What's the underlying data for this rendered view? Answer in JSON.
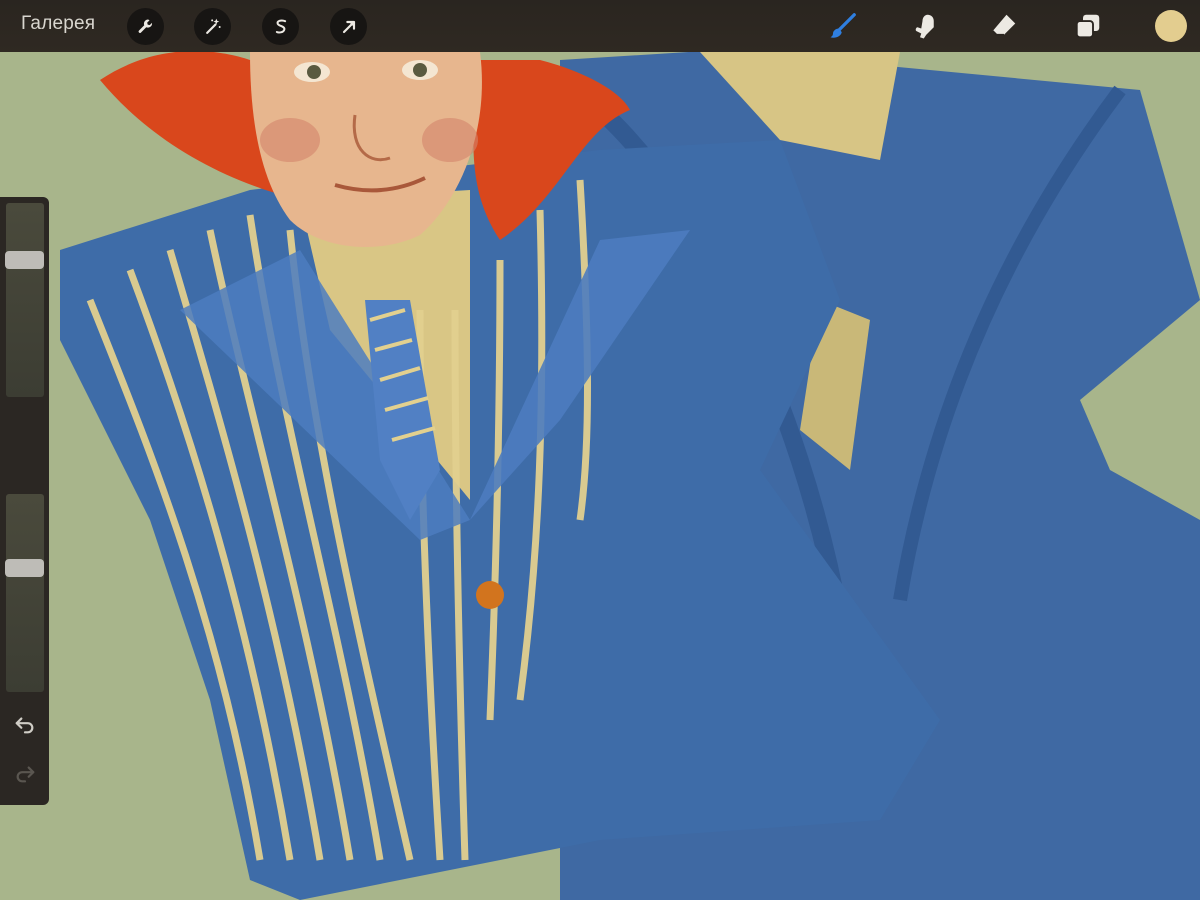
{
  "app": {
    "gallery_label": "Галерея"
  },
  "toolbar": {
    "left_tools": [
      "wrench-icon",
      "magic-wand-icon",
      "selection-icon",
      "transform-arrow-icon"
    ],
    "right_tools": [
      "brush-icon",
      "smudge-icon",
      "eraser-icon",
      "layers-icon"
    ],
    "active_tool": "brush-icon",
    "active_tool_color": "#2f7fe0",
    "current_color": "#e3cd8f"
  },
  "sidebar": {
    "brush_size_level": 0.73,
    "opacity_level": 0.64,
    "undo_icon": "undo-icon",
    "redo_icon": "redo-icon"
  }
}
